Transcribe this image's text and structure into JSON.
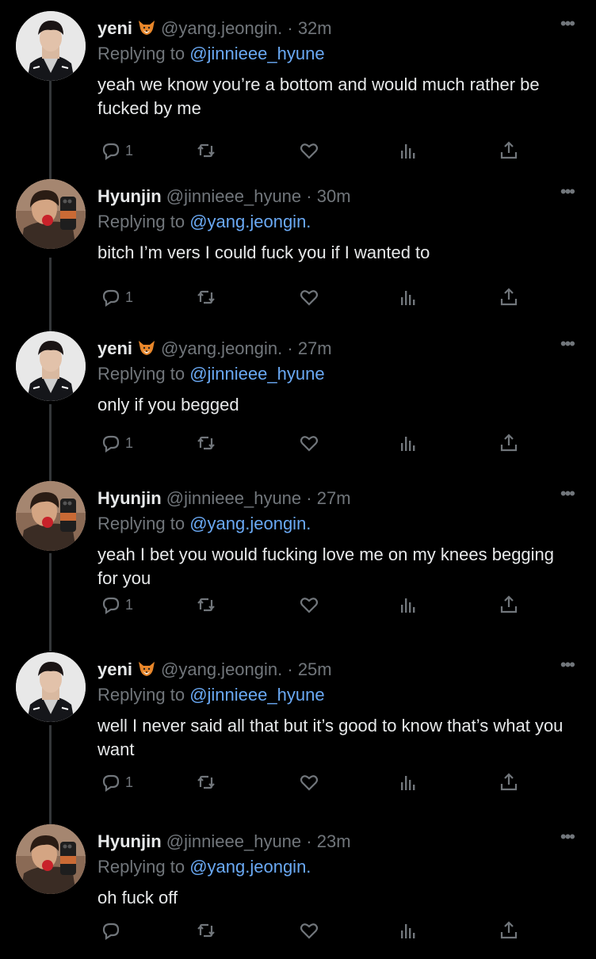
{
  "tweets": [
    {
      "name": "yeni",
      "handle": "@yang.jeongin.",
      "time": "32m",
      "replying_prefix": "Replying to",
      "replying_to": "@jinnieee_hyune",
      "text": "yeah we know you’re a bottom and would much rather be fucked by me",
      "reply_count": "1",
      "avatar": "user-yeni",
      "has_emoji": true
    },
    {
      "name": "Hyunjin",
      "handle": "@jinnieee_hyune",
      "time": "30m",
      "replying_prefix": "Replying to",
      "replying_to": "@yang.jeongin.",
      "text": "bitch I’m vers I could fuck you if I wanted to",
      "reply_count": "1",
      "avatar": "user-hyunjin",
      "has_emoji": false
    },
    {
      "name": "yeni",
      "handle": "@yang.jeongin.",
      "time": "27m",
      "replying_prefix": "Replying to",
      "replying_to": "@jinnieee_hyune",
      "text": "only if you begged",
      "reply_count": "1",
      "avatar": "user-yeni",
      "has_emoji": true
    },
    {
      "name": "Hyunjin",
      "handle": "@jinnieee_hyune",
      "time": "27m",
      "replying_prefix": "Replying to",
      "replying_to": "@yang.jeongin.",
      "text": "yeah I bet you would fucking love me on my knees begging for you",
      "reply_count": "1",
      "avatar": "user-hyunjin",
      "has_emoji": false
    },
    {
      "name": "yeni",
      "handle": "@yang.jeongin.",
      "time": "25m",
      "replying_prefix": "Replying to",
      "replying_to": "@jinnieee_hyune",
      "text": "well I never said all that but it’s good to know that’s what you want",
      "reply_count": "1",
      "avatar": "user-yeni",
      "has_emoji": true
    },
    {
      "name": "Hyunjin",
      "handle": "@jinnieee_hyune",
      "time": "23m",
      "replying_prefix": "Replying to",
      "replying_to": "@yang.jeongin.",
      "text": "oh fuck off",
      "reply_count": "",
      "avatar": "user-hyunjin",
      "has_emoji": false
    }
  ],
  "ui": {
    "separator": " · ",
    "more_glyph": "•••"
  },
  "icons": {
    "reply": "reply-icon",
    "retweet": "retweet-icon",
    "like": "heart-icon",
    "views": "analytics-icon",
    "share": "share-icon",
    "emoji": "fox-emoji-icon"
  },
  "colors": {
    "background": "#000000",
    "text": "#e7e9ea",
    "muted": "#71767b",
    "link": "#6aa9f4",
    "thread_line": "#333639"
  }
}
